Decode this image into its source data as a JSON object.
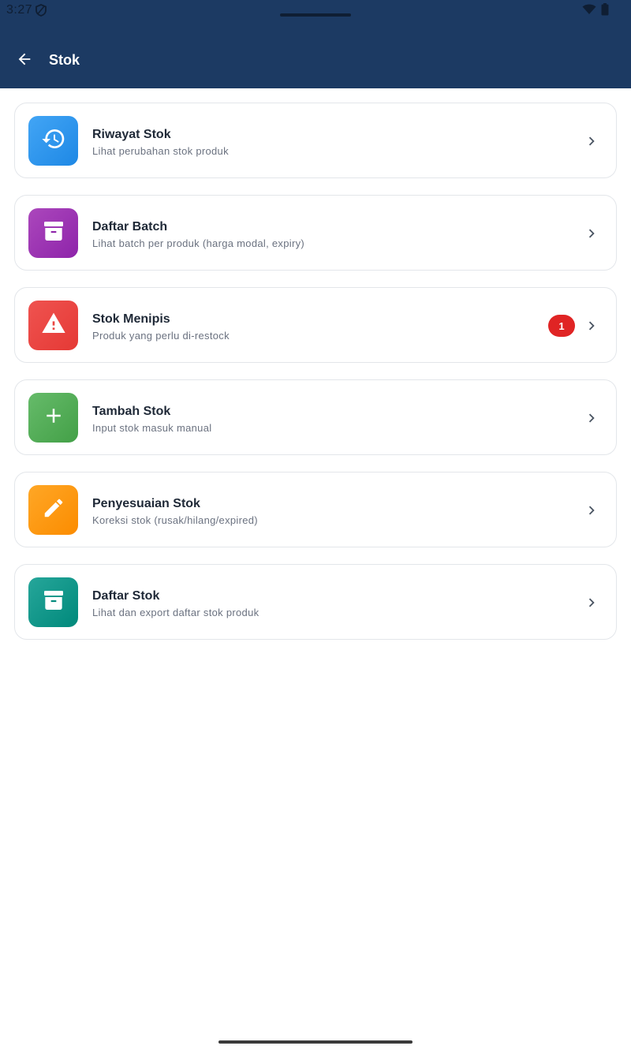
{
  "status_bar": {
    "time": "3:27"
  },
  "header": {
    "title": "Stok",
    "background": "#1c3a63"
  },
  "menu": {
    "items": [
      {
        "title": "Riwayat Stok",
        "subtitle": "Lihat perubahan stok produk",
        "icon": "history-icon",
        "color_from": "#42a5f5",
        "color_to": "#1e88e5"
      },
      {
        "title": "Daftar Batch",
        "subtitle": "Lihat batch per produk (harga modal, expiry)",
        "icon": "archive-icon",
        "color_from": "#ab47bc",
        "color_to": "#8e24aa"
      },
      {
        "title": "Stok Menipis",
        "subtitle": "Produk yang perlu di-restock",
        "icon": "warning-icon",
        "color_from": "#ef5350",
        "color_to": "#e53935",
        "badge": "1"
      },
      {
        "title": "Tambah Stok",
        "subtitle": "Input stok masuk manual",
        "icon": "plus-icon",
        "color_from": "#66bb6a",
        "color_to": "#43a047"
      },
      {
        "title": "Penyesuaian Stok",
        "subtitle": "Koreksi stok (rusak/hilang/expired)",
        "icon": "pencil-icon",
        "color_from": "#ffa726",
        "color_to": "#fb8c00"
      },
      {
        "title": "Daftar Stok",
        "subtitle": "Lihat dan export daftar stok produk",
        "icon": "archive-icon",
        "color_from": "#26a69a",
        "color_to": "#00897b"
      }
    ]
  }
}
